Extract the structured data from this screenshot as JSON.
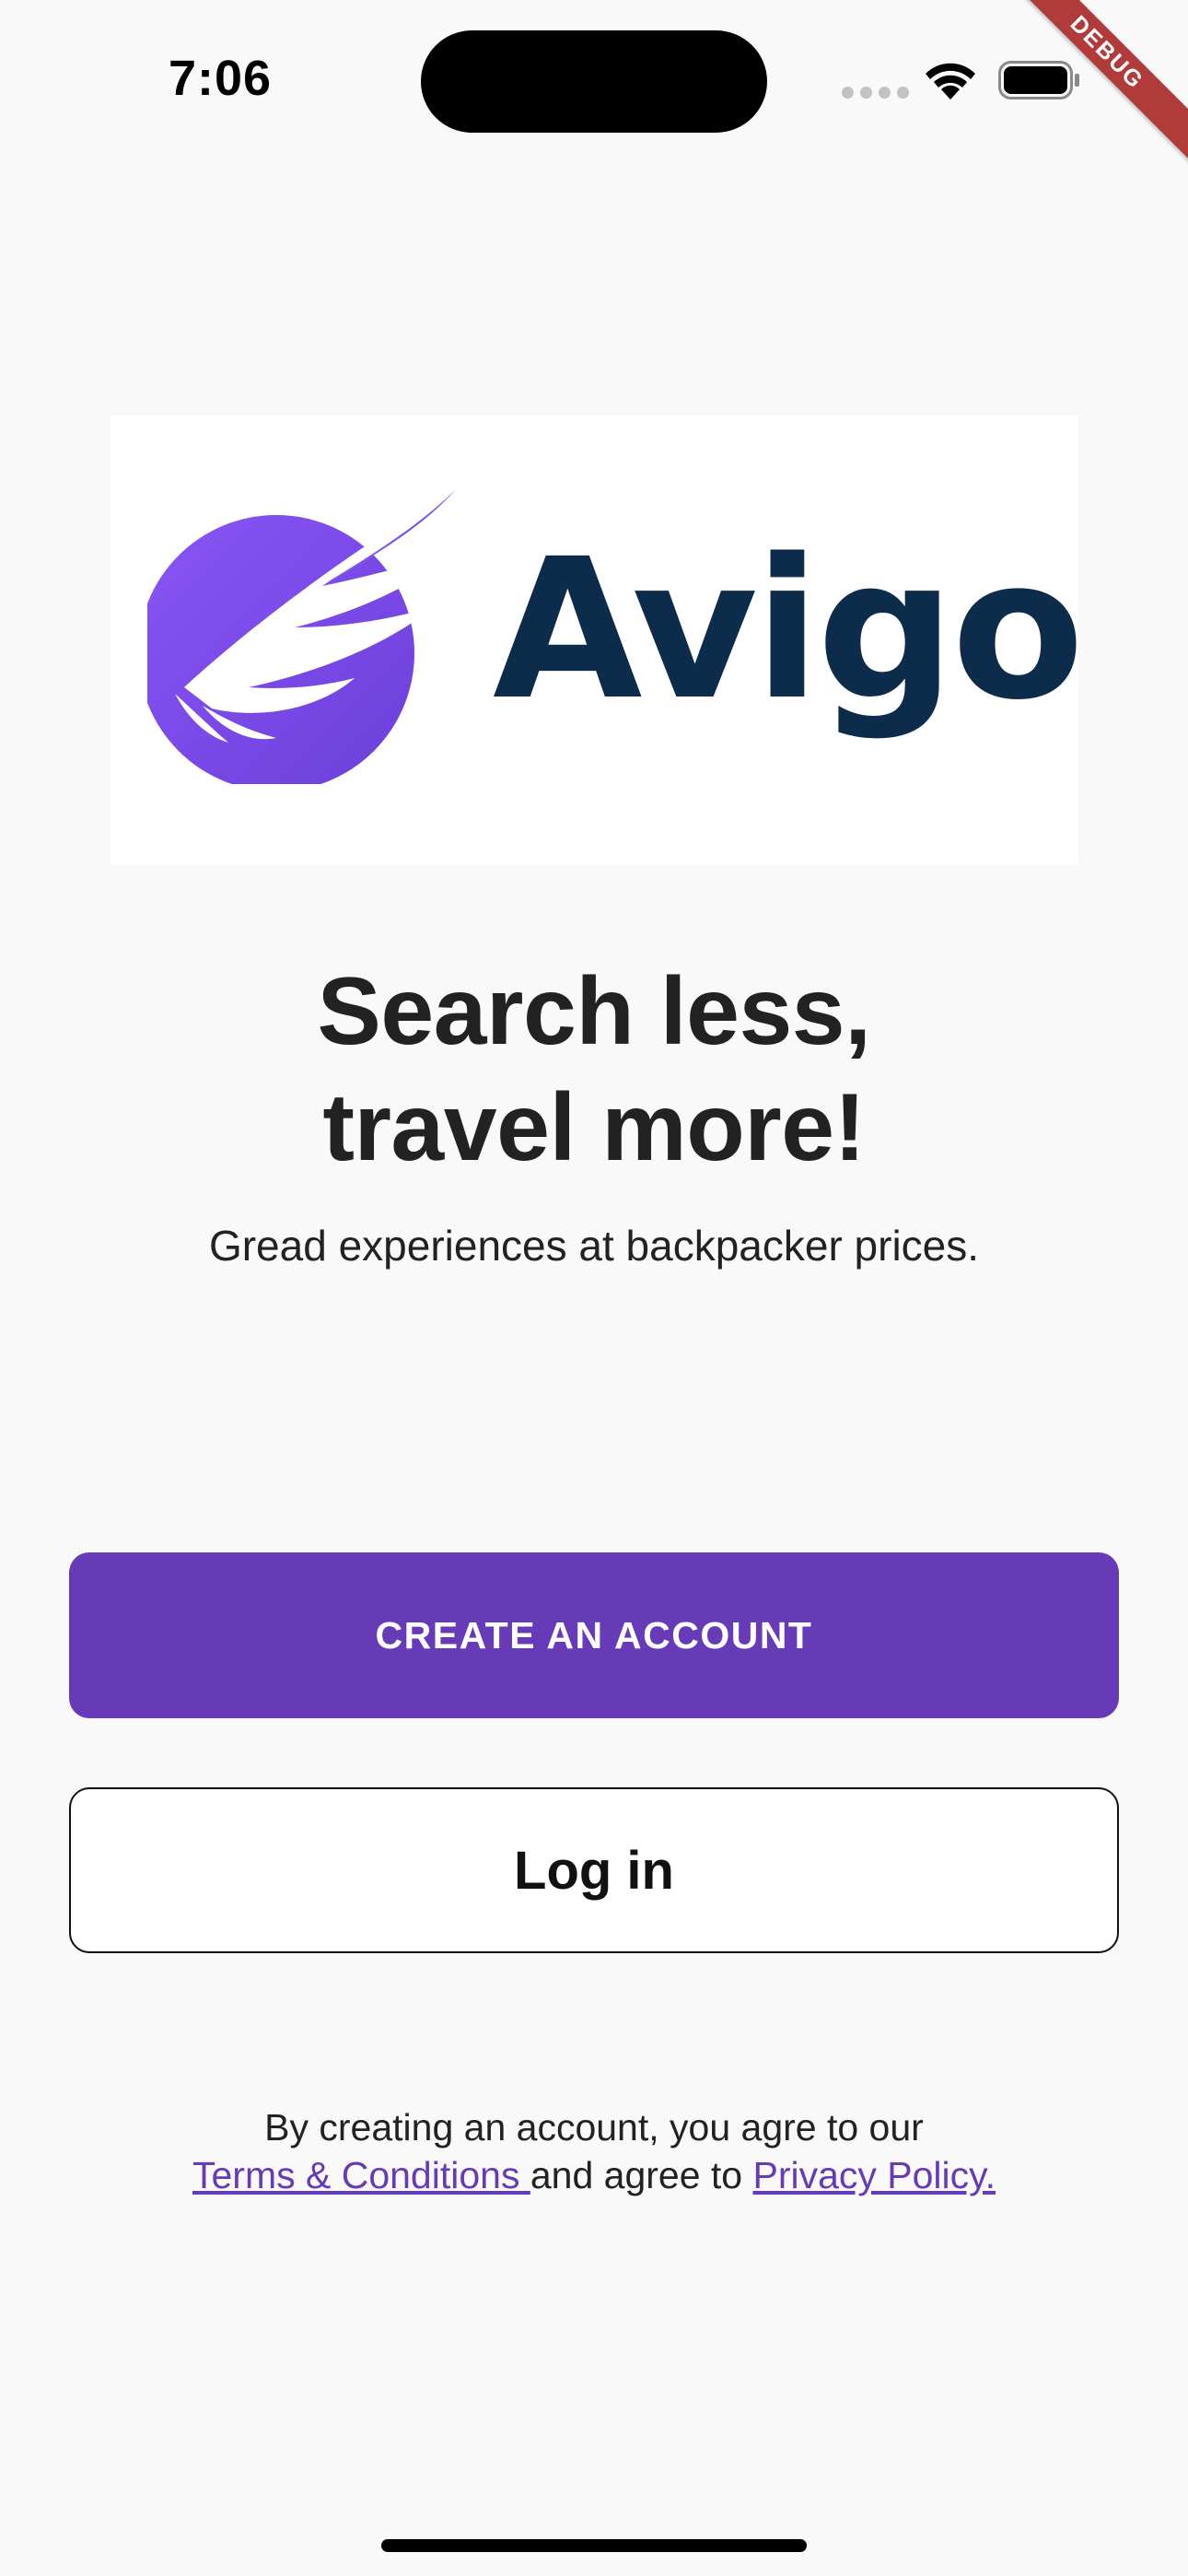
{
  "status_bar": {
    "time": "7:06"
  },
  "debug_banner": "DEBUG",
  "logo": {
    "wordmark": "Avigo",
    "mark_icon": "wing-globe-logo-icon",
    "colors": {
      "mark": "#7b4ef0",
      "wordmark": "#0d2b4a"
    }
  },
  "hero": {
    "headline_line1": "Search less,",
    "headline_line2": "travel more!",
    "subtitle": "Gread experiences at backpacker prices."
  },
  "actions": {
    "create_account_label": "CREATE AN ACCOUNT",
    "login_label": "Log in"
  },
  "legal": {
    "line1": "By creating an account, you agre to our",
    "terms_link": "Terms &  Conditions ",
    "middle_text": "and agree to ",
    "privacy_link": "Privacy Policy."
  },
  "colors": {
    "accent": "#673ab7",
    "background": "#f9f9f9",
    "text": "#222222"
  }
}
